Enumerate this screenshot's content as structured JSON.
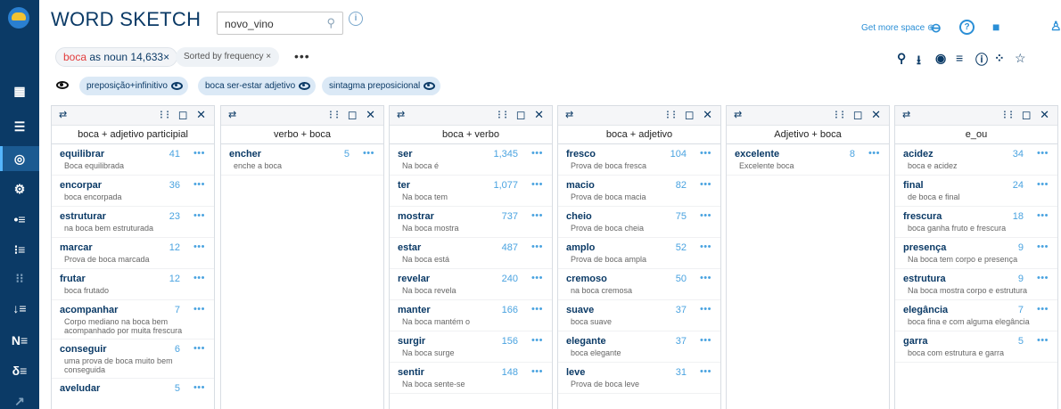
{
  "app": {
    "title": "WORD SKETCH"
  },
  "corpus_field": {
    "value": "novo_vino"
  },
  "chips": {
    "lemma": "boca",
    "rest": " as noun 14,633",
    "close": "×",
    "sort": "Sorted by frequency",
    "sort_close": "×",
    "more": "•••"
  },
  "filters": [
    {
      "label": "preposição+infinitivo"
    },
    {
      "label": "boca ser-estar adjetivo"
    },
    {
      "label": "sintagma preposicional"
    }
  ],
  "header_right": {
    "get_more_space": "Get more space"
  },
  "icons": {
    "info": "i",
    "search": "⚲",
    "plus_circle": "⊕",
    "link": "⊖",
    "help": "?",
    "feedback": "■",
    "user": "♙",
    "zoom": "⚲",
    "download": "⭳",
    "eye": "◉",
    "filter": "≡",
    "info2": "ⓘ",
    "cluster": "⁘",
    "star": "☆"
  },
  "columns": [
    {
      "title": "boca + adjetivo participial",
      "rows": [
        {
          "word": "equilibrar",
          "count": "41",
          "example": "Boca equilibrada"
        },
        {
          "word": "encorpar",
          "count": "36",
          "example": "boca encorpada"
        },
        {
          "word": "estruturar",
          "count": "23",
          "example": "na boca bem estruturada"
        },
        {
          "word": "marcar",
          "count": "12",
          "example": "Prova de boca marcada"
        },
        {
          "word": "frutar",
          "count": "12",
          "example": "boca frutado"
        },
        {
          "word": "acompanhar",
          "count": "7",
          "example": "Corpo mediano na boca bem acompanhado por muita frescura",
          "tall": true
        },
        {
          "word": "conseguir",
          "count": "6",
          "example": "uma prova de boca muito bem conseguida",
          "tall": true
        },
        {
          "word": "aveludar",
          "count": "5",
          "example": ""
        }
      ]
    },
    {
      "title": "verbo + boca",
      "rows": [
        {
          "word": "encher",
          "count": "5",
          "example": "enche a boca"
        }
      ]
    },
    {
      "title": "boca + verbo",
      "rows": [
        {
          "word": "ser",
          "count": "1,345",
          "example": "Na boca é"
        },
        {
          "word": "ter",
          "count": "1,077",
          "example": "Na boca tem"
        },
        {
          "word": "mostrar",
          "count": "737",
          "example": "Na boca mostra"
        },
        {
          "word": "estar",
          "count": "487",
          "example": "Na boca está"
        },
        {
          "word": "revelar",
          "count": "240",
          "example": "Na boca revela"
        },
        {
          "word": "manter",
          "count": "166",
          "example": "Na boca mantém o"
        },
        {
          "word": "surgir",
          "count": "156",
          "example": "Na boca surge"
        },
        {
          "word": "sentir",
          "count": "148",
          "example": "Na boca sente-se"
        }
      ]
    },
    {
      "title": "boca + adjetivo",
      "rows": [
        {
          "word": "fresco",
          "count": "104",
          "example": "Prova de boca fresca"
        },
        {
          "word": "macio",
          "count": "82",
          "example": "Prova de boca macia"
        },
        {
          "word": "cheio",
          "count": "75",
          "example": "Prova de boca cheia"
        },
        {
          "word": "amplo",
          "count": "52",
          "example": "Prova de boca ampla"
        },
        {
          "word": "cremoso",
          "count": "50",
          "example": "na boca cremosa"
        },
        {
          "word": "suave",
          "count": "37",
          "example": "boca suave"
        },
        {
          "word": "elegante",
          "count": "37",
          "example": "boca elegante"
        },
        {
          "word": "leve",
          "count": "31",
          "example": "Prova de boca leve"
        }
      ]
    },
    {
      "title": "Adjetivo + boca",
      "rows": [
        {
          "word": "excelente",
          "count": "8",
          "example": "Excelente boca"
        }
      ]
    },
    {
      "title": "e_ou",
      "rows": [
        {
          "word": "acidez",
          "count": "34",
          "example": "boca e acidez"
        },
        {
          "word": "final",
          "count": "24",
          "example": "de boca e final"
        },
        {
          "word": "frescura",
          "count": "18",
          "example": "boca ganha fruto e frescura"
        },
        {
          "word": "presença",
          "count": "9",
          "example": "Na boca tem corpo e presença"
        },
        {
          "word": "estrutura",
          "count": "9",
          "example": "Na boca mostra corpo e estrutura"
        },
        {
          "word": "elegância",
          "count": "7",
          "example": "boca fina e com alguma elegância"
        },
        {
          "word": "garra",
          "count": "5",
          "example": "boca com estrutura e garra"
        }
      ]
    }
  ],
  "column_controls": {
    "swap": "⇄",
    "icons": "⁝⁝ ◻ ✕"
  },
  "sidebar": {
    "icons": [
      "▦",
      "☰",
      "◎",
      "⚙",
      "•≡",
      "⁝≡",
      "⁝⁝",
      "↓≡",
      "N≡",
      "δ≡",
      "↗"
    ]
  },
  "row_more": "•••"
}
